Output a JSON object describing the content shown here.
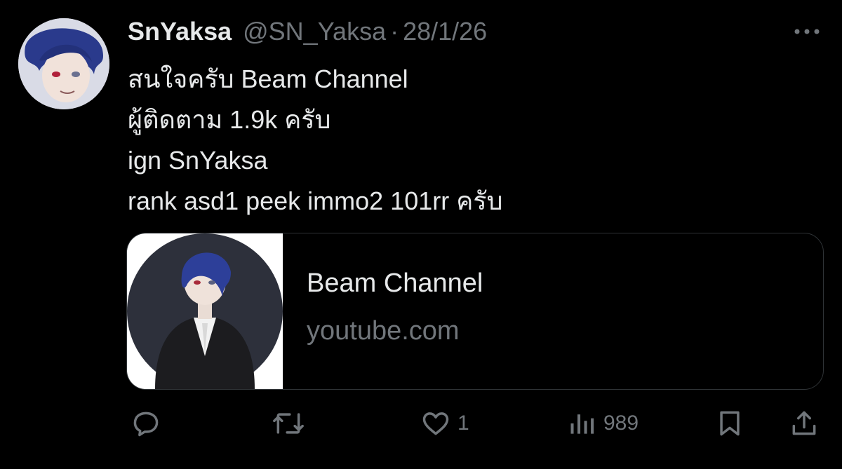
{
  "tweet": {
    "display_name": "SnYaksa",
    "handle": "@SN_Yaksa",
    "separator": "·",
    "date": "28/1/26",
    "lines": [
      "สนใจครับ Beam Channel",
      "ผู้ติดตาม 1.9k ครับ",
      "ign SnYaksa",
      "rank asd1 peek immo2 101rr ครับ"
    ]
  },
  "card": {
    "title": "Beam Channel",
    "domain": "youtube.com"
  },
  "actions": {
    "reply_icon": "reply-icon",
    "retweet_icon": "retweet-icon",
    "like_icon": "heart-icon",
    "like_count": "1",
    "views_icon": "views-icon",
    "views_count": "989",
    "bookmark_icon": "bookmark-icon",
    "share_icon": "share-icon"
  },
  "colors": {
    "background": "#000000",
    "text": "#e7e9ea",
    "muted": "#71767b",
    "border": "#2f3336"
  }
}
